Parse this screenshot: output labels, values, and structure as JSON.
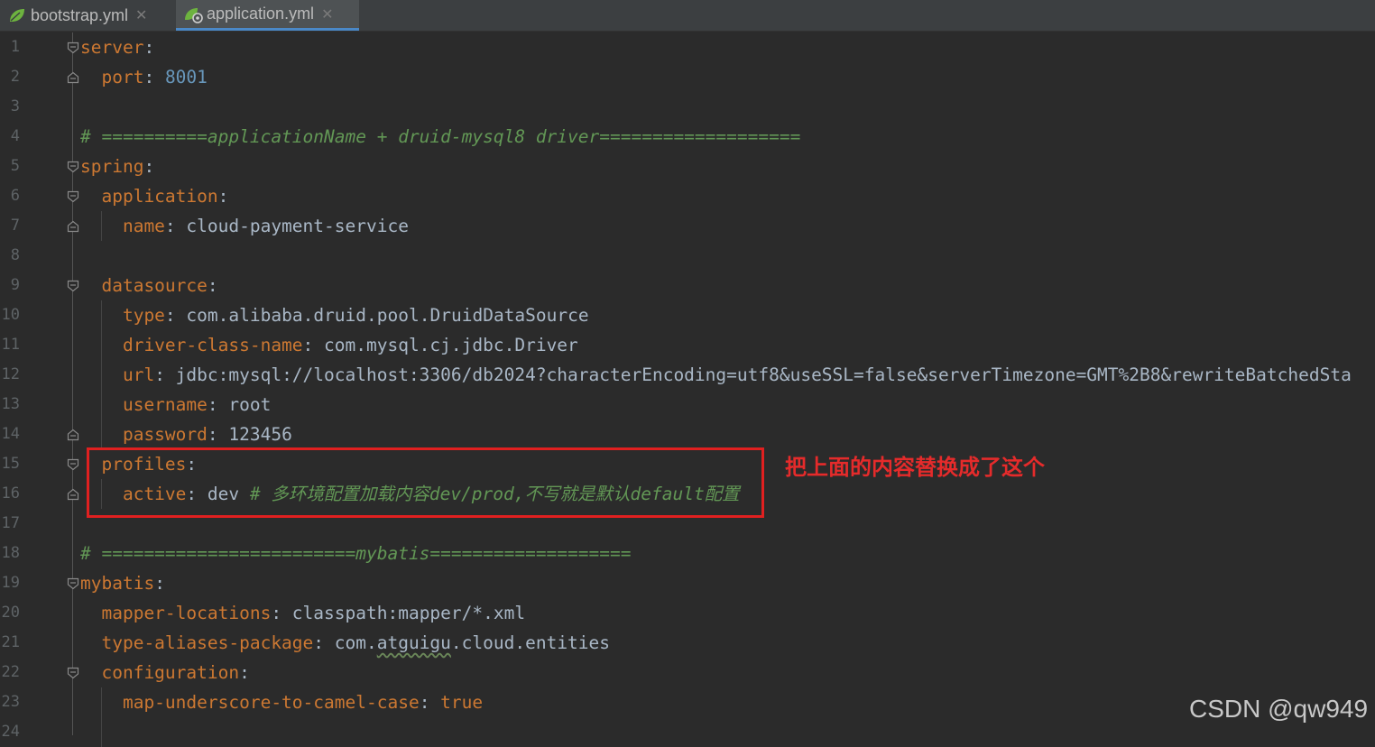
{
  "tabs": [
    {
      "label": "bootstrap.yml",
      "active": false,
      "icon": "spring-leaf-icon"
    },
    {
      "label": "application.yml",
      "active": true,
      "icon": "spring-config-icon"
    }
  ],
  "colors": {
    "background": "#2b2b2b",
    "key": "#cc7832",
    "number": "#6897bb",
    "comment": "#629755",
    "text": "#a9b7c6",
    "annotation": "#e52b2b",
    "highlight_border": "#e02020"
  },
  "lines": [
    {
      "n": "1",
      "segs": [
        {
          "t": "server",
          "c": "k"
        },
        {
          "t": ":",
          "c": "p"
        }
      ]
    },
    {
      "n": "2",
      "segs": [
        {
          "t": "  port",
          "c": "k"
        },
        {
          "t": ": ",
          "c": "p"
        },
        {
          "t": "8001",
          "c": "n"
        }
      ]
    },
    {
      "n": "3",
      "segs": []
    },
    {
      "n": "4",
      "segs": [
        {
          "t": "# ==========applicationName + druid-mysql8 driver===================",
          "c": "c"
        }
      ]
    },
    {
      "n": "5",
      "segs": [
        {
          "t": "spring",
          "c": "k"
        },
        {
          "t": ":",
          "c": "p"
        }
      ]
    },
    {
      "n": "6",
      "segs": [
        {
          "t": "  application",
          "c": "k"
        },
        {
          "t": ":",
          "c": "p"
        }
      ]
    },
    {
      "n": "7",
      "segs": [
        {
          "t": "    name",
          "c": "k"
        },
        {
          "t": ": cloud-payment-service",
          "c": "p"
        }
      ]
    },
    {
      "n": "8",
      "segs": []
    },
    {
      "n": "9",
      "segs": [
        {
          "t": "  datasource",
          "c": "k"
        },
        {
          "t": ":",
          "c": "p"
        }
      ]
    },
    {
      "n": "10",
      "segs": [
        {
          "t": "    type",
          "c": "k"
        },
        {
          "t": ": ",
          "c": "p"
        },
        {
          "t": "com",
          "c": "p"
        },
        {
          "t": ".",
          "c": "p"
        },
        {
          "t": "alibaba",
          "c": "p"
        },
        {
          "t": ".",
          "c": "p"
        },
        {
          "t": "druid",
          "c": "p"
        },
        {
          "t": ".",
          "c": "p"
        },
        {
          "t": "pool",
          "c": "p"
        },
        {
          "t": ".",
          "c": "p"
        },
        {
          "t": "DruidDataSource",
          "c": "p"
        }
      ]
    },
    {
      "n": "11",
      "segs": [
        {
          "t": "    driver-class-name",
          "c": "k"
        },
        {
          "t": ": com.mysql.cj.jdbc.Driver",
          "c": "p"
        }
      ]
    },
    {
      "n": "12",
      "segs": [
        {
          "t": "    url",
          "c": "k"
        },
        {
          "t": ": jdbc:mysql://localhost:3306/db2024?characterEncoding=utf8&useSSL=false&serverTimezone=GMT%2B8&rewriteBatchedSta",
          "c": "p"
        }
      ]
    },
    {
      "n": "13",
      "segs": [
        {
          "t": "    username",
          "c": "k"
        },
        {
          "t": ": root",
          "c": "p"
        }
      ]
    },
    {
      "n": "14",
      "segs": [
        {
          "t": "    password",
          "c": "k"
        },
        {
          "t": ": 123456",
          "c": "p"
        }
      ]
    },
    {
      "n": "15",
      "segs": [
        {
          "t": "  profiles",
          "c": "k"
        },
        {
          "t": ":",
          "c": "p"
        }
      ]
    },
    {
      "n": "16",
      "segs": [
        {
          "t": "    active",
          "c": "k"
        },
        {
          "t": ": dev ",
          "c": "p"
        },
        {
          "t": "# 多环境配置加载内容dev/prod,不写就是默认default配置",
          "c": "c"
        }
      ]
    },
    {
      "n": "17",
      "segs": []
    },
    {
      "n": "18",
      "segs": [
        {
          "t": "# ========================mybatis===================",
          "c": "c"
        }
      ]
    },
    {
      "n": "19",
      "segs": [
        {
          "t": "mybatis",
          "c": "k"
        },
        {
          "t": ":",
          "c": "p"
        }
      ]
    },
    {
      "n": "20",
      "segs": [
        {
          "t": "  mapper-locations",
          "c": "k"
        },
        {
          "t": ": classpath:mapper/*.xml",
          "c": "p"
        }
      ]
    },
    {
      "n": "21",
      "segs": [
        {
          "t": "  type-aliases-package",
          "c": "k"
        },
        {
          "t": ": com.",
          "c": "p"
        },
        {
          "t": "atguigu",
          "c": "p",
          "squiggle": true
        },
        {
          "t": ".cloud.entities",
          "c": "p"
        }
      ]
    },
    {
      "n": "22",
      "segs": [
        {
          "t": "  configuration",
          "c": "k"
        },
        {
          "t": ":",
          "c": "p"
        }
      ]
    },
    {
      "n": "23",
      "segs": [
        {
          "t": "    map-underscore-to-camel-case",
          "c": "k"
        },
        {
          "t": ": ",
          "c": "p"
        },
        {
          "t": "true",
          "c": "k"
        }
      ]
    },
    {
      "n": "24",
      "segs": []
    }
  ],
  "folds": {
    "open": [
      "1",
      "5",
      "6",
      "9",
      "15",
      "19",
      "22"
    ],
    "close": [
      "2",
      "7",
      "14",
      "16"
    ]
  },
  "annotation": "把上面的内容替换成了这个",
  "watermark": "CSDN @qw949"
}
